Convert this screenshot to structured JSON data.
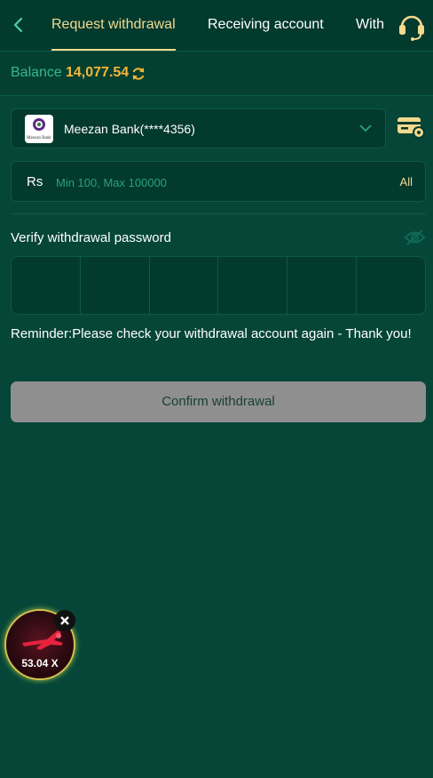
{
  "header": {
    "tabs": [
      "Request withdrawal",
      "Receiving account",
      "With"
    ]
  },
  "balance": {
    "label": "Balance",
    "value": "14,077.54"
  },
  "bank": {
    "logo_text": "Meezan Bank",
    "name": "Meezan Bank(****4356)"
  },
  "amount": {
    "currency": "Rs",
    "placeholder": "Min 100, Max 100000",
    "all_label": "All"
  },
  "verify": {
    "label": "Verify withdrawal password",
    "pin_length": 6
  },
  "reminder": "Reminder:Please check your withdrawal account again - Thank you!",
  "confirm_label": "Confirm withdrawal",
  "float_game": {
    "multiplier": "53.04 X"
  },
  "colors": {
    "background": "#064638",
    "accent": "#f3d98e",
    "balance": "#f2b73a",
    "muted_green": "#35b58f",
    "disabled_button": "#8f8f8f"
  }
}
